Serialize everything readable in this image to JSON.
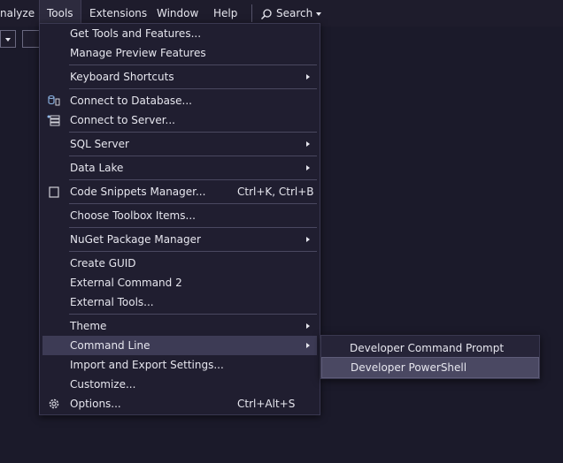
{
  "menubar": {
    "items": [
      "nalyze",
      "Tools",
      "Extensions",
      "Window",
      "Help"
    ],
    "search_label": "Search"
  },
  "tools_menu": {
    "items": [
      {
        "label": "Get Tools and Features..."
      },
      {
        "label": "Manage Preview Features"
      },
      {
        "label": "Keyboard Shortcuts",
        "submenu": true
      },
      {
        "label": "Connect to Database...",
        "icon": "database-connect-icon"
      },
      {
        "label": "Connect to Server...",
        "icon": "server-connect-icon"
      },
      {
        "label": "SQL Server",
        "submenu": true
      },
      {
        "label": "Data Lake",
        "submenu": true
      },
      {
        "label": "Code Snippets Manager...",
        "shortcut": "Ctrl+K, Ctrl+B",
        "icon": "snippet-icon"
      },
      {
        "label": "Choose Toolbox Items..."
      },
      {
        "label": "NuGet Package Manager",
        "submenu": true
      },
      {
        "label": "Create GUID"
      },
      {
        "label": "External Command 2"
      },
      {
        "label": "External Tools..."
      },
      {
        "label": "Theme",
        "submenu": true
      },
      {
        "label": "Command Line",
        "submenu": true,
        "highlighted": true
      },
      {
        "label": "Import and Export Settings..."
      },
      {
        "label": "Customize..."
      },
      {
        "label": "Options...",
        "shortcut": "Ctrl+Alt+S",
        "icon": "gear-icon"
      }
    ]
  },
  "command_line_submenu": {
    "items": [
      {
        "label": "Developer Command Prompt"
      },
      {
        "label": "Developer PowerShell",
        "highlighted": true
      }
    ]
  },
  "colors": {
    "background": "#1b1a2a",
    "menu_background": "#201e30",
    "highlight": "#3d3b55",
    "text": "#e6e6ee"
  }
}
